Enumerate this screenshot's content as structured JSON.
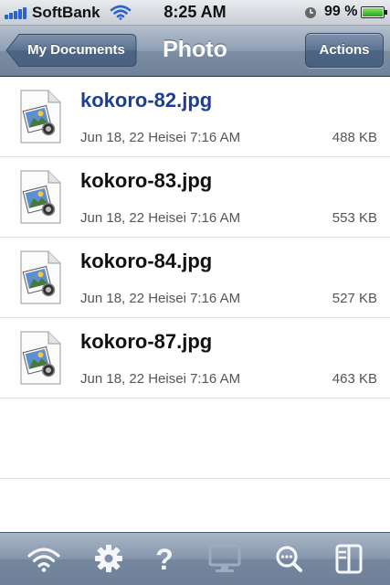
{
  "status_bar": {
    "carrier": "SoftBank",
    "time": "8:25 AM",
    "battery_percent": "99 %",
    "battery_level": 0.99,
    "signal_bars": 5
  },
  "nav": {
    "back_label": "My Documents",
    "title": "Photo",
    "actions_label": "Actions"
  },
  "files": [
    {
      "name": "kokoro-82.jpg",
      "date": "Jun 18, 22 Heisei 7:16 AM",
      "size": "488 KB",
      "selected": true
    },
    {
      "name": "kokoro-83.jpg",
      "date": "Jun 18, 22 Heisei 7:16 AM",
      "size": "553 KB",
      "selected": false
    },
    {
      "name": "kokoro-84.jpg",
      "date": "Jun 18, 22 Heisei 7:16 AM",
      "size": "527 KB",
      "selected": false
    },
    {
      "name": "kokoro-87.jpg",
      "date": "Jun 18, 22 Heisei 7:16 AM",
      "size": "463 KB",
      "selected": false
    }
  ],
  "tab_bar": {
    "tabs": [
      {
        "icon": "wifi-icon",
        "enabled": true
      },
      {
        "icon": "gear-icon",
        "enabled": true
      },
      {
        "icon": "help-icon",
        "enabled": true
      },
      {
        "icon": "monitor-icon",
        "enabled": false
      },
      {
        "icon": "search-icon",
        "enabled": true
      },
      {
        "icon": "split-view-icon",
        "enabled": true
      }
    ]
  },
  "colors": {
    "selected_text": "#1c3f94",
    "nav_bar": "#8596ac"
  }
}
